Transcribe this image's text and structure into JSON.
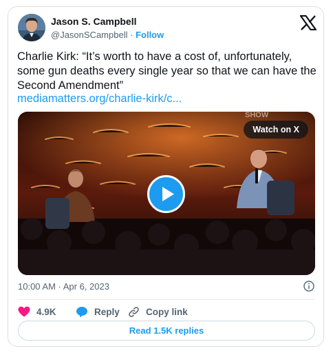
{
  "author": {
    "name": "Jason S. Campbell",
    "handle": "@JasonSCampbell",
    "separator": "·",
    "follow_label": "Follow"
  },
  "tweet": {
    "text": "Charlie Kirk: “It’s worth to have a cost of, unfortunately, some gun deaths every single year so that we can have the Second Amendment”",
    "link": "mediamatters.org/charlie-kirk/c..."
  },
  "media": {
    "watch_label": "Watch on X",
    "play_icon": "play-icon"
  },
  "meta": {
    "timestamp": "10:00 AM · Apr 6, 2023"
  },
  "actions": {
    "like_count": "4.9K",
    "reply_label": "Reply",
    "copy_label": "Copy link"
  },
  "footer": {
    "read_replies_label": "Read 1.5K replies"
  },
  "colors": {
    "accent": "#1d9bf0",
    "like": "#f91880",
    "text": "#0f1419",
    "muted": "#536471"
  }
}
